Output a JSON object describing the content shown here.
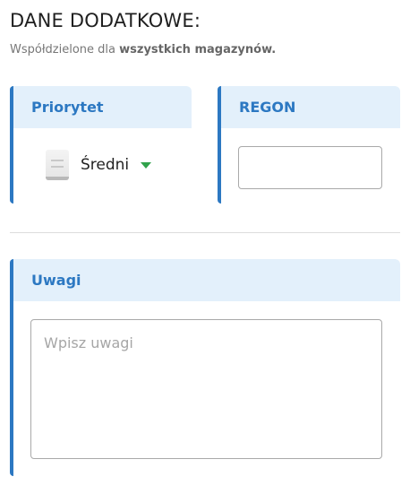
{
  "header": {
    "title": "DANE DODATKOWE:",
    "subtitle_prefix": "Współdzielone dla ",
    "subtitle_bold": "wszystkich magazynów."
  },
  "priority": {
    "label": "Priorytet",
    "value": "Średni",
    "icon": "priority-medium-icon"
  },
  "regon": {
    "label": "REGON",
    "value": ""
  },
  "notes": {
    "label": "Uwagi",
    "placeholder": "Wpisz uwagi",
    "value": ""
  },
  "colors": {
    "accent": "#2c78c2",
    "header_bg": "#e3f0fb",
    "caret": "#31a24c"
  }
}
